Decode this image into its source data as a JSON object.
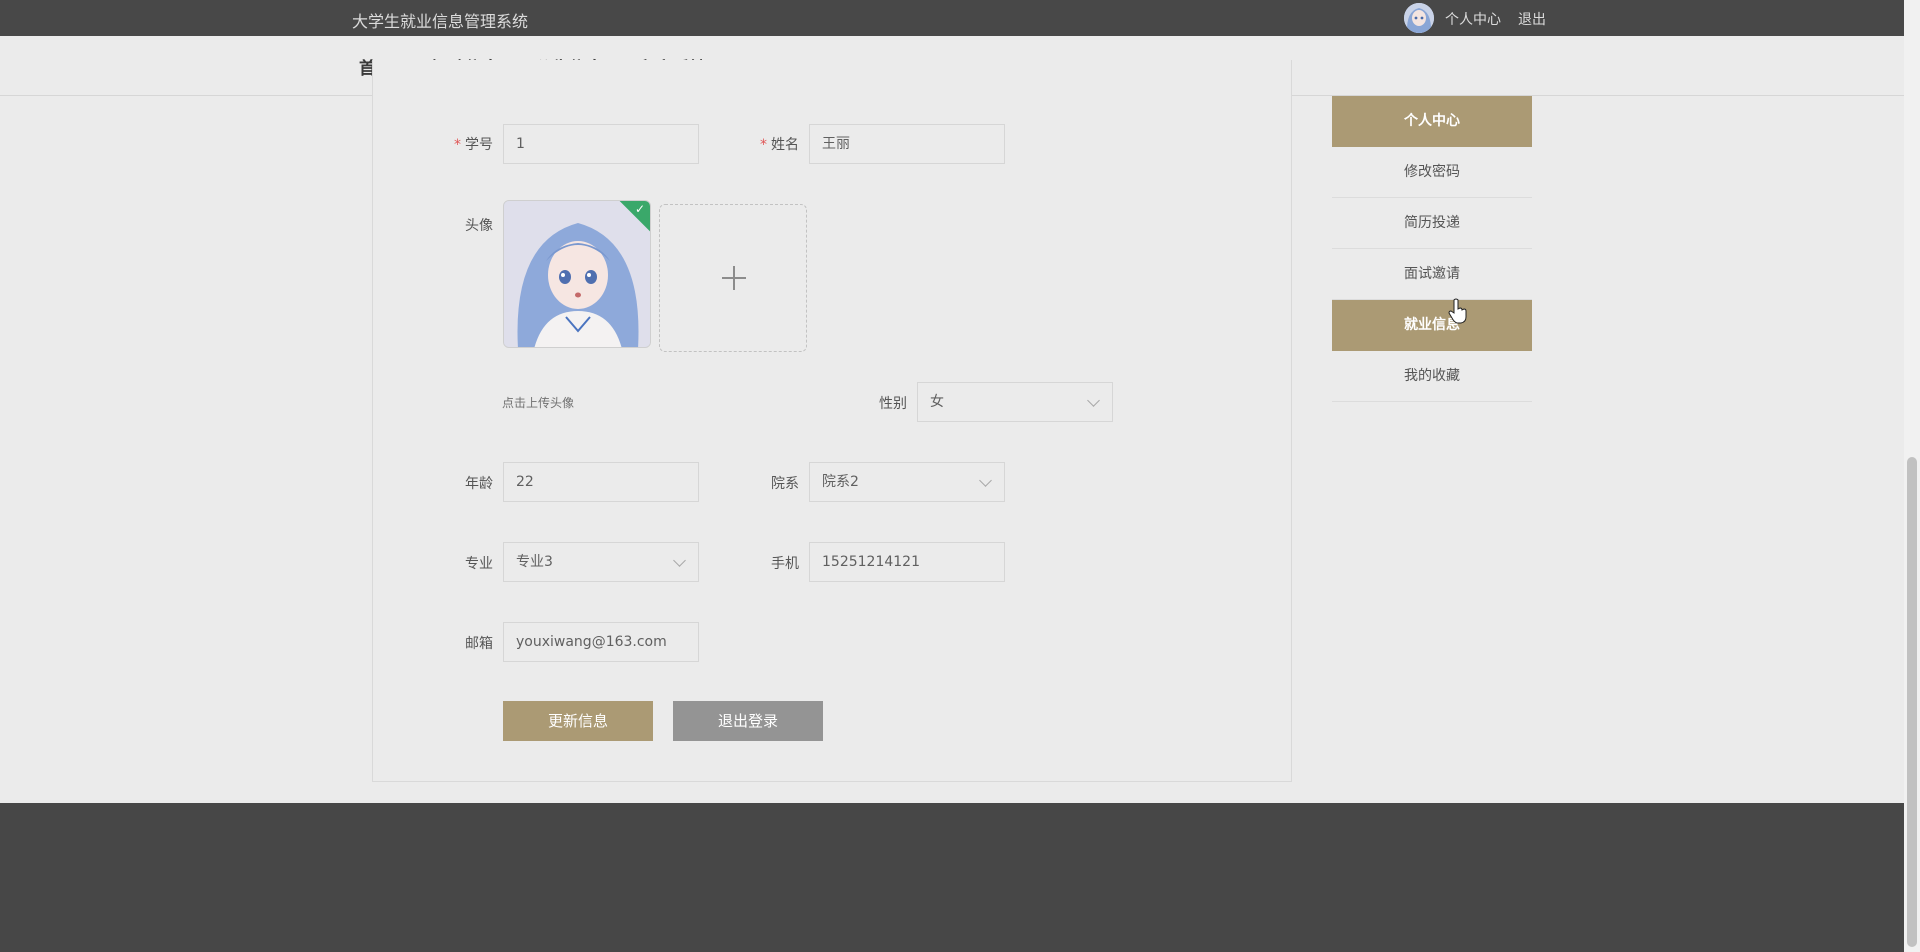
{
  "header": {
    "site_title": "大学生就业信息管理系统",
    "personal_center": "个人中心",
    "logout": "退出"
  },
  "nav": {
    "items": [
      "首页",
      "招聘信息",
      "公告信息",
      "留言反馈"
    ]
  },
  "form": {
    "student_id_label": "学号",
    "student_id_value": "1",
    "name_label": "姓名",
    "name_value": "王丽",
    "avatar_label": "头像",
    "upload_hint": "点击上传头像",
    "gender_label": "性别",
    "gender_value": "女",
    "age_label": "年龄",
    "age_value": "22",
    "department_label": "院系",
    "department_value": "院系2",
    "major_label": "专业",
    "major_value": "专业3",
    "phone_label": "手机",
    "phone_value": "15251214121",
    "email_label": "邮箱",
    "email_value": "youxiwang@163.com",
    "update_button": "更新信息",
    "logout_button": "退出登录"
  },
  "side_menu": {
    "items": [
      {
        "label": "个人中心",
        "active": true
      },
      {
        "label": "修改密码",
        "active": false
      },
      {
        "label": "简历投递",
        "active": false
      },
      {
        "label": "面试邀请",
        "active": false
      },
      {
        "label": "就业信息",
        "active": true
      },
      {
        "label": "我的收藏",
        "active": false
      }
    ]
  },
  "colors": {
    "accent": "#ab9a74",
    "topbar": "#484848",
    "footer": "#474747",
    "secondary_button": "#949494"
  }
}
